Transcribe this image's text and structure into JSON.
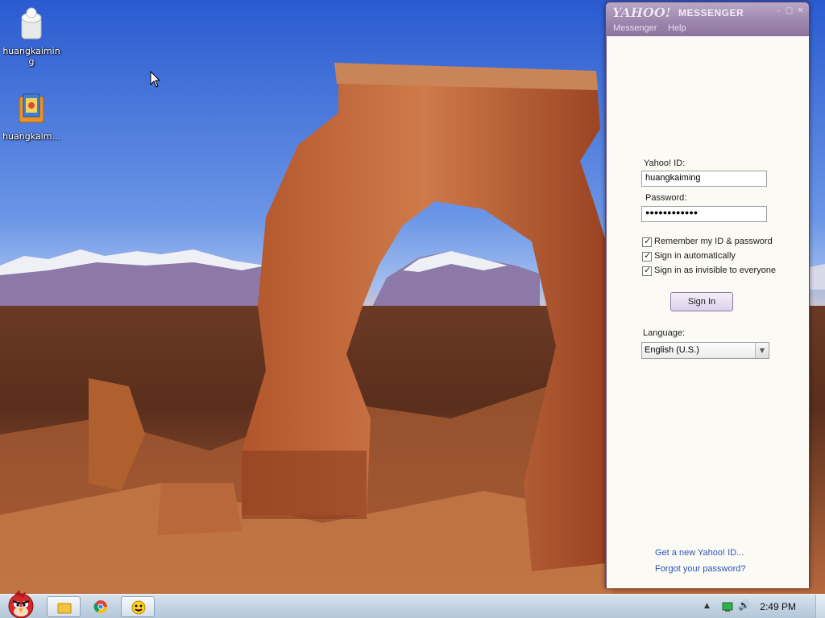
{
  "desktop": {
    "icons": [
      {
        "label": "huangkaiming"
      },
      {
        "label": "huangkaim..."
      }
    ]
  },
  "messenger": {
    "logo": "YAHOO!",
    "app_title": "MESSENGER",
    "window_buttons": {
      "minimize": "–",
      "maximize": "□",
      "close": "✕"
    },
    "menu": [
      "Messenger",
      "Help"
    ],
    "form": {
      "yahoo_id_label": "Yahoo! ID:",
      "yahoo_id_value": "huangkaiming",
      "password_label": "Password:",
      "password_value": "●●●●●●●●●●●●",
      "checkboxes": [
        {
          "label": "Remember my ID & password",
          "checked": true
        },
        {
          "label": "Sign in automatically",
          "checked": true
        },
        {
          "label": "Sign in as invisible to everyone",
          "checked": true
        }
      ],
      "sign_in_label": "Sign In",
      "language_label": "Language:",
      "language_value": "English (U.S.)"
    },
    "links": {
      "new_id": "Get a new Yahoo! ID...",
      "forgot_password": "Forgot your password?"
    },
    "colors": {
      "frame": "#7a5c8f",
      "body": "#fbfaf5",
      "link": "#2b55b8"
    }
  },
  "taskbar": {
    "clock": "2:49 PM",
    "tray_up_arrow": "▲",
    "tray_volume": "🔊"
  }
}
